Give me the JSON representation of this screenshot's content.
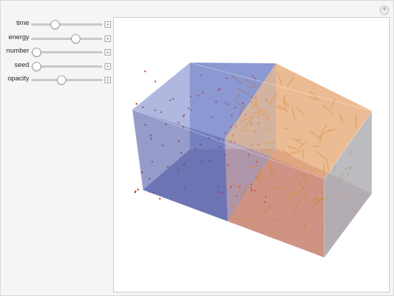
{
  "controls": [
    {
      "id": "time",
      "label": "time",
      "value": 0.33
    },
    {
      "id": "energy",
      "label": "energy",
      "value": 0.62
    },
    {
      "id": "number",
      "label": "number",
      "value": 0.07
    },
    {
      "id": "seed",
      "label": "seed",
      "value": 0.07
    },
    {
      "id": "opacity",
      "label": "opacity",
      "value": 0.42
    }
  ],
  "icons": {
    "corner": "plus-circle-icon",
    "stepper": "plus-icon"
  },
  "colors": {
    "cold_region": "#5a66b6",
    "hot_region": "#e8a060",
    "floor_hot": "#c98478",
    "cold_particle": "#c3302f",
    "hot_particle": "#d4883a"
  }
}
